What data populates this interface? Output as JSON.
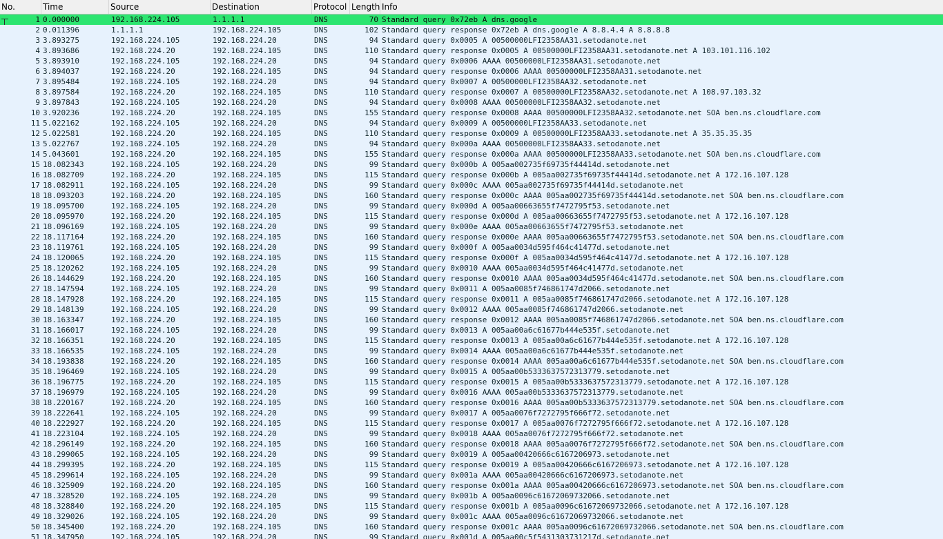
{
  "columns": {
    "no": "No.",
    "time": "Time",
    "source": "Source",
    "destination": "Destination",
    "protocol": "Protocol",
    "length": "Length",
    "info": "Info"
  },
  "colors": {
    "row_background": "#e7f2fd",
    "selected_background": "#2ce570",
    "header_background": "#f0f0f0"
  },
  "selected_packet": "1",
  "packets": [
    {
      "no": "1",
      "time": "0.000000",
      "src": "192.168.224.105",
      "dst": "1.1.1.1",
      "proto": "DNS",
      "len": "70",
      "info": "Standard query 0x72eb A dns.google"
    },
    {
      "no": "2",
      "time": "0.011396",
      "src": "1.1.1.1",
      "dst": "192.168.224.105",
      "proto": "DNS",
      "len": "102",
      "info": "Standard query response 0x72eb A dns.google A 8.8.4.4 A 8.8.8.8"
    },
    {
      "no": "3",
      "time": "3.893275",
      "src": "192.168.224.105",
      "dst": "192.168.224.20",
      "proto": "DNS",
      "len": "94",
      "info": "Standard query 0x0005 A 00500000LFI2358AA31.setodanote.net"
    },
    {
      "no": "4",
      "time": "3.893686",
      "src": "192.168.224.20",
      "dst": "192.168.224.105",
      "proto": "DNS",
      "len": "110",
      "info": "Standard query response 0x0005 A 00500000LFI2358AA31.setodanote.net A 103.101.116.102"
    },
    {
      "no": "5",
      "time": "3.893910",
      "src": "192.168.224.105",
      "dst": "192.168.224.20",
      "proto": "DNS",
      "len": "94",
      "info": "Standard query 0x0006 AAAA 00500000LFI2358AA31.setodanote.net"
    },
    {
      "no": "6",
      "time": "3.894037",
      "src": "192.168.224.20",
      "dst": "192.168.224.105",
      "proto": "DNS",
      "len": "94",
      "info": "Standard query response 0x0006 AAAA 00500000LFI2358AA31.setodanote.net"
    },
    {
      "no": "7",
      "time": "3.895484",
      "src": "192.168.224.105",
      "dst": "192.168.224.20",
      "proto": "DNS",
      "len": "94",
      "info": "Standard query 0x0007 A 00500000LFI2358AA32.setodanote.net"
    },
    {
      "no": "8",
      "time": "3.897584",
      "src": "192.168.224.20",
      "dst": "192.168.224.105",
      "proto": "DNS",
      "len": "110",
      "info": "Standard query response 0x0007 A 00500000LFI2358AA32.setodanote.net A 108.97.103.32"
    },
    {
      "no": "9",
      "time": "3.897843",
      "src": "192.168.224.105",
      "dst": "192.168.224.20",
      "proto": "DNS",
      "len": "94",
      "info": "Standard query 0x0008 AAAA 00500000LFI2358AA32.setodanote.net"
    },
    {
      "no": "10",
      "time": "3.920236",
      "src": "192.168.224.20",
      "dst": "192.168.224.105",
      "proto": "DNS",
      "len": "155",
      "info": "Standard query response 0x0008 AAAA 00500000LFI2358AA32.setodanote.net SOA ben.ns.cloudflare.com"
    },
    {
      "no": "11",
      "time": "5.022162",
      "src": "192.168.224.105",
      "dst": "192.168.224.20",
      "proto": "DNS",
      "len": "94",
      "info": "Standard query 0x0009 A 00500000LFI2358AA33.setodanote.net"
    },
    {
      "no": "12",
      "time": "5.022581",
      "src": "192.168.224.20",
      "dst": "192.168.224.105",
      "proto": "DNS",
      "len": "110",
      "info": "Standard query response 0x0009 A 00500000LFI2358AA33.setodanote.net A 35.35.35.35"
    },
    {
      "no": "13",
      "time": "5.022767",
      "src": "192.168.224.105",
      "dst": "192.168.224.20",
      "proto": "DNS",
      "len": "94",
      "info": "Standard query 0x000a AAAA 00500000LFI2358AA33.setodanote.net"
    },
    {
      "no": "14",
      "time": "5.043601",
      "src": "192.168.224.20",
      "dst": "192.168.224.105",
      "proto": "DNS",
      "len": "155",
      "info": "Standard query response 0x000a AAAA 00500000LFI2358AA33.setodanote.net SOA ben.ns.cloudflare.com"
    },
    {
      "no": "15",
      "time": "18.082343",
      "src": "192.168.224.105",
      "dst": "192.168.224.20",
      "proto": "DNS",
      "len": "99",
      "info": "Standard query 0x000b A 005aa002735f69735f44414d.setodanote.net"
    },
    {
      "no": "16",
      "time": "18.082709",
      "src": "192.168.224.20",
      "dst": "192.168.224.105",
      "proto": "DNS",
      "len": "115",
      "info": "Standard query response 0x000b A 005aa002735f69735f44414d.setodanote.net A 172.16.107.128"
    },
    {
      "no": "17",
      "time": "18.082911",
      "src": "192.168.224.105",
      "dst": "192.168.224.20",
      "proto": "DNS",
      "len": "99",
      "info": "Standard query 0x000c AAAA 005aa002735f69735f44414d.setodanote.net"
    },
    {
      "no": "18",
      "time": "18.093203",
      "src": "192.168.224.20",
      "dst": "192.168.224.105",
      "proto": "DNS",
      "len": "160",
      "info": "Standard query response 0x000c AAAA 005aa002735f69735f44414d.setodanote.net SOA ben.ns.cloudflare.com"
    },
    {
      "no": "19",
      "time": "18.095700",
      "src": "192.168.224.105",
      "dst": "192.168.224.20",
      "proto": "DNS",
      "len": "99",
      "info": "Standard query 0x000d A 005aa00663655f7472795f53.setodanote.net"
    },
    {
      "no": "20",
      "time": "18.095970",
      "src": "192.168.224.20",
      "dst": "192.168.224.105",
      "proto": "DNS",
      "len": "115",
      "info": "Standard query response 0x000d A 005aa00663655f7472795f53.setodanote.net A 172.16.107.128"
    },
    {
      "no": "21",
      "time": "18.096169",
      "src": "192.168.224.105",
      "dst": "192.168.224.20",
      "proto": "DNS",
      "len": "99",
      "info": "Standard query 0x000e AAAA 005aa00663655f7472795f53.setodanote.net"
    },
    {
      "no": "22",
      "time": "18.117164",
      "src": "192.168.224.20",
      "dst": "192.168.224.105",
      "proto": "DNS",
      "len": "160",
      "info": "Standard query response 0x000e AAAA 005aa00663655f7472795f53.setodanote.net SOA ben.ns.cloudflare.com"
    },
    {
      "no": "23",
      "time": "18.119761",
      "src": "192.168.224.105",
      "dst": "192.168.224.20",
      "proto": "DNS",
      "len": "99",
      "info": "Standard query 0x000f A 005aa0034d595f464c41477d.setodanote.net"
    },
    {
      "no": "24",
      "time": "18.120065",
      "src": "192.168.224.20",
      "dst": "192.168.224.105",
      "proto": "DNS",
      "len": "115",
      "info": "Standard query response 0x000f A 005aa0034d595f464c41477d.setodanote.net A 172.16.107.128"
    },
    {
      "no": "25",
      "time": "18.120262",
      "src": "192.168.224.105",
      "dst": "192.168.224.20",
      "proto": "DNS",
      "len": "99",
      "info": "Standard query 0x0010 AAAA 005aa0034d595f464c41477d.setodanote.net"
    },
    {
      "no": "26",
      "time": "18.144629",
      "src": "192.168.224.20",
      "dst": "192.168.224.105",
      "proto": "DNS",
      "len": "160",
      "info": "Standard query response 0x0010 AAAA 005aa0034d595f464c41477d.setodanote.net SOA ben.ns.cloudflare.com"
    },
    {
      "no": "27",
      "time": "18.147594",
      "src": "192.168.224.105",
      "dst": "192.168.224.20",
      "proto": "DNS",
      "len": "99",
      "info": "Standard query 0x0011 A 005aa0085f746861747d2066.setodanote.net"
    },
    {
      "no": "28",
      "time": "18.147928",
      "src": "192.168.224.20",
      "dst": "192.168.224.105",
      "proto": "DNS",
      "len": "115",
      "info": "Standard query response 0x0011 A 005aa0085f746861747d2066.setodanote.net A 172.16.107.128"
    },
    {
      "no": "29",
      "time": "18.148139",
      "src": "192.168.224.105",
      "dst": "192.168.224.20",
      "proto": "DNS",
      "len": "99",
      "info": "Standard query 0x0012 AAAA 005aa0085f746861747d2066.setodanote.net"
    },
    {
      "no": "30",
      "time": "18.163347",
      "src": "192.168.224.20",
      "dst": "192.168.224.105",
      "proto": "DNS",
      "len": "160",
      "info": "Standard query response 0x0012 AAAA 005aa0085f746861747d2066.setodanote.net SOA ben.ns.cloudflare.com"
    },
    {
      "no": "31",
      "time": "18.166017",
      "src": "192.168.224.105",
      "dst": "192.168.224.20",
      "proto": "DNS",
      "len": "99",
      "info": "Standard query 0x0013 A 005aa00a6c61677b444e535f.setodanote.net"
    },
    {
      "no": "32",
      "time": "18.166351",
      "src": "192.168.224.20",
      "dst": "192.168.224.105",
      "proto": "DNS",
      "len": "115",
      "info": "Standard query response 0x0013 A 005aa00a6c61677b444e535f.setodanote.net A 172.16.107.128"
    },
    {
      "no": "33",
      "time": "18.166535",
      "src": "192.168.224.105",
      "dst": "192.168.224.20",
      "proto": "DNS",
      "len": "99",
      "info": "Standard query 0x0014 AAAA 005aa00a6c61677b444e535f.setodanote.net"
    },
    {
      "no": "34",
      "time": "18.193838",
      "src": "192.168.224.20",
      "dst": "192.168.224.105",
      "proto": "DNS",
      "len": "160",
      "info": "Standard query response 0x0014 AAAA 005aa00a6c61677b444e535f.setodanote.net SOA ben.ns.cloudflare.com"
    },
    {
      "no": "35",
      "time": "18.196469",
      "src": "192.168.224.105",
      "dst": "192.168.224.20",
      "proto": "DNS",
      "len": "99",
      "info": "Standard query 0x0015 A 005aa00b5333637572313779.setodanote.net"
    },
    {
      "no": "36",
      "time": "18.196775",
      "src": "192.168.224.20",
      "dst": "192.168.224.105",
      "proto": "DNS",
      "len": "115",
      "info": "Standard query response 0x0015 A 005aa00b5333637572313779.setodanote.net A 172.16.107.128"
    },
    {
      "no": "37",
      "time": "18.196979",
      "src": "192.168.224.105",
      "dst": "192.168.224.20",
      "proto": "DNS",
      "len": "99",
      "info": "Standard query 0x0016 AAAA 005aa00b5333637572313779.setodanote.net"
    },
    {
      "no": "38",
      "time": "18.220167",
      "src": "192.168.224.20",
      "dst": "192.168.224.105",
      "proto": "DNS",
      "len": "160",
      "info": "Standard query response 0x0016 AAAA 005aa00b5333637572313779.setodanote.net SOA ben.ns.cloudflare.com"
    },
    {
      "no": "39",
      "time": "18.222641",
      "src": "192.168.224.105",
      "dst": "192.168.224.20",
      "proto": "DNS",
      "len": "99",
      "info": "Standard query 0x0017 A 005aa0076f7272795f666f72.setodanote.net"
    },
    {
      "no": "40",
      "time": "18.222927",
      "src": "192.168.224.20",
      "dst": "192.168.224.105",
      "proto": "DNS",
      "len": "115",
      "info": "Standard query response 0x0017 A 005aa0076f7272795f666f72.setodanote.net A 172.16.107.128"
    },
    {
      "no": "41",
      "time": "18.223104",
      "src": "192.168.224.105",
      "dst": "192.168.224.20",
      "proto": "DNS",
      "len": "99",
      "info": "Standard query 0x0018 AAAA 005aa0076f7272795f666f72.setodanote.net"
    },
    {
      "no": "42",
      "time": "18.296149",
      "src": "192.168.224.20",
      "dst": "192.168.224.105",
      "proto": "DNS",
      "len": "160",
      "info": "Standard query response 0x0018 AAAA 005aa0076f7272795f666f72.setodanote.net SOA ben.ns.cloudflare.com"
    },
    {
      "no": "43",
      "time": "18.299065",
      "src": "192.168.224.105",
      "dst": "192.168.224.20",
      "proto": "DNS",
      "len": "99",
      "info": "Standard query 0x0019 A 005aa00420666c6167206973.setodanote.net"
    },
    {
      "no": "44",
      "time": "18.299395",
      "src": "192.168.224.20",
      "dst": "192.168.224.105",
      "proto": "DNS",
      "len": "115",
      "info": "Standard query response 0x0019 A 005aa00420666c6167206973.setodanote.net A 172.16.107.128"
    },
    {
      "no": "45",
      "time": "18.299614",
      "src": "192.168.224.105",
      "dst": "192.168.224.20",
      "proto": "DNS",
      "len": "99",
      "info": "Standard query 0x001a AAAA 005aa00420666c6167206973.setodanote.net"
    },
    {
      "no": "46",
      "time": "18.325909",
      "src": "192.168.224.20",
      "dst": "192.168.224.105",
      "proto": "DNS",
      "len": "160",
      "info": "Standard query response 0x001a AAAA 005aa00420666c6167206973.setodanote.net SOA ben.ns.cloudflare.com"
    },
    {
      "no": "47",
      "time": "18.328520",
      "src": "192.168.224.105",
      "dst": "192.168.224.20",
      "proto": "DNS",
      "len": "99",
      "info": "Standard query 0x001b A 005aa0096c61672069732066.setodanote.net"
    },
    {
      "no": "48",
      "time": "18.328840",
      "src": "192.168.224.20",
      "dst": "192.168.224.105",
      "proto": "DNS",
      "len": "115",
      "info": "Standard query response 0x001b A 005aa0096c61672069732066.setodanote.net A 172.16.107.128"
    },
    {
      "no": "49",
      "time": "18.329026",
      "src": "192.168.224.105",
      "dst": "192.168.224.20",
      "proto": "DNS",
      "len": "99",
      "info": "Standard query 0x001c AAAA 005aa0096c61672069732066.setodanote.net"
    },
    {
      "no": "50",
      "time": "18.345400",
      "src": "192.168.224.20",
      "dst": "192.168.224.105",
      "proto": "DNS",
      "len": "160",
      "info": "Standard query response 0x001c AAAA 005aa0096c61672069732066.setodanote.net SOA ben.ns.cloudflare.com"
    },
    {
      "no": "51",
      "time": "18.347950",
      "src": "192.168.224.105",
      "dst": "192.168.224.20",
      "proto": "DNS",
      "len": "99",
      "info": "Standard query 0x001d A 005aa00c5f5431303731217d.setodanote.net"
    }
  ]
}
